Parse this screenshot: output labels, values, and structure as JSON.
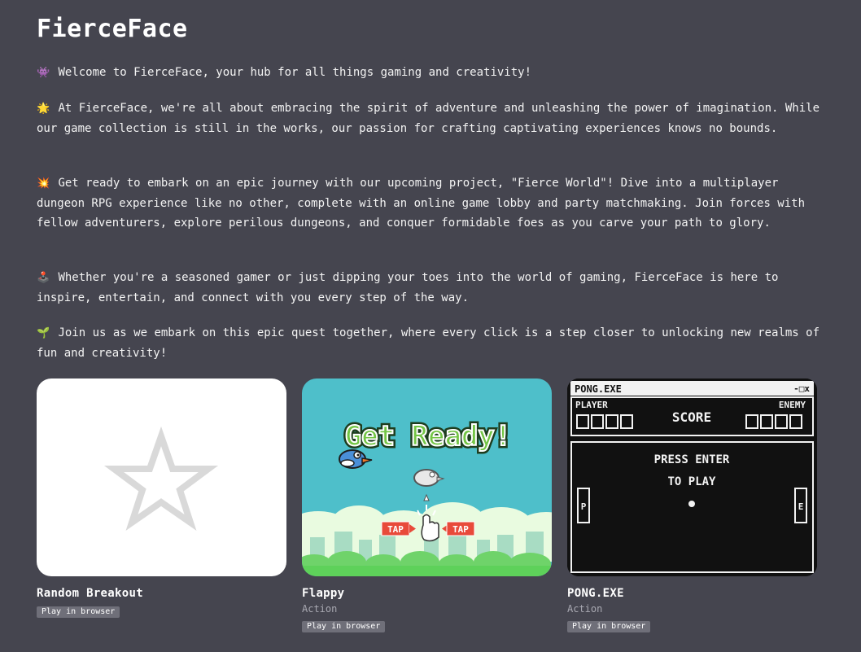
{
  "site": {
    "title": "FierceFace"
  },
  "intro": [
    {
      "emoji": "👾",
      "text": "Welcome to FierceFace, your hub for all things gaming and creativity!"
    },
    {
      "emoji": "🌟",
      "text": "At FierceFace, we're all about embracing the spirit of adventure and unleashing the power of imagination. While our game collection is still in the works, our passion for crafting captivating experiences knows no bounds."
    },
    {
      "emoji": "💥",
      "text": "Get ready to embark on an epic journey with our upcoming project, \"Fierce World\"! Dive into a multiplayer dungeon RPG experience like no other, complete with an online game lobby and party matchmaking. Join forces with fellow adventurers, explore perilous dungeons, and conquer formidable foes as you carve your path to glory."
    },
    {
      "emoji": "🕹️",
      "text": "Whether you're a seasoned gamer or just dipping your toes into the world of gaming, FierceFace is here to inspire, entertain, and connect with you every step of the way."
    },
    {
      "emoji": "🌱",
      "text": "Join us as we embark on this epic quest together, where every click is a step closer to unlocking new realms of fun and creativity!"
    }
  ],
  "games": [
    {
      "title": "Random Breakout",
      "genre": "",
      "badge": "Play in browser",
      "thumb_icon": "star-outline-icon"
    },
    {
      "title": "Flappy",
      "genre": "Action",
      "badge": "Play in browser",
      "thumb_art": {
        "headline": "Get Ready!",
        "tap_left": "TAP",
        "tap_right": "TAP"
      }
    },
    {
      "title": "PONG.EXE",
      "genre": "Action",
      "badge": "Play in browser",
      "thumb_art": {
        "window_title": "PONG.EXE",
        "window_controls": "-□x",
        "player_label": "PLAYER",
        "score_label": "SCORE",
        "enemy_label": "ENEMY",
        "prompt_line1": "PRESS ENTER",
        "prompt_line2": "TO PLAY",
        "paddle_left": "P",
        "paddle_right": "E"
      }
    }
  ],
  "colors": {
    "background": "#45454f",
    "badge": "#6f6f79",
    "flappy_sky": "#4ebfca",
    "flappy_ground": "#5ed15a"
  }
}
